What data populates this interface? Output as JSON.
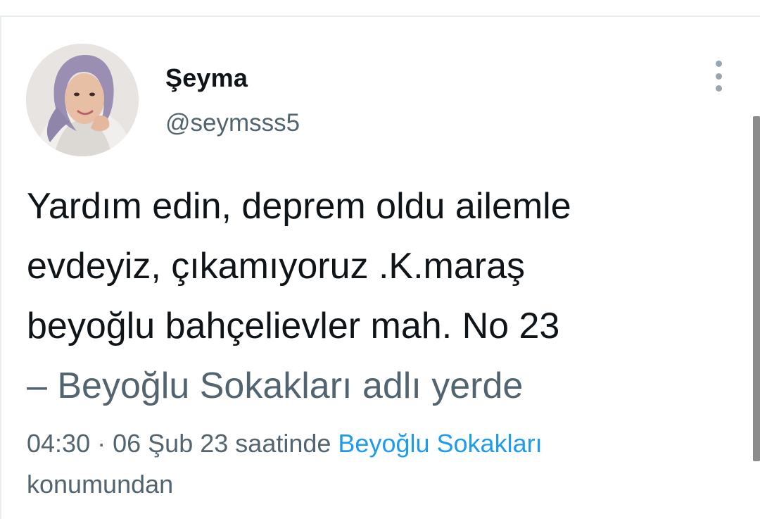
{
  "tweet": {
    "author": {
      "display_name": "Şeyma",
      "username": "@seymsss5",
      "avatar_icon": "profile-photo"
    },
    "more_icon": "more-vertical-icon",
    "text_lines": [
      "Yardım edin, deprem oldu ailemle",
      "evdeyiz, çıkamıyoruz .K.maraş",
      "beyoğlu bahçelievler mah. No 23"
    ],
    "place_line": "– Beyoğlu Sokakları adlı yerde",
    "meta": {
      "time": "04:30",
      "separator": "·",
      "date": "06 Şub 23",
      "suffix": "saatinde",
      "location": "Beyoğlu Sokakları",
      "location_suffix": "konumundan"
    }
  },
  "colors": {
    "text_primary": "#0f1419",
    "text_secondary": "#536471",
    "link": "#1d9bf0",
    "divider": "#e6ecf0"
  }
}
